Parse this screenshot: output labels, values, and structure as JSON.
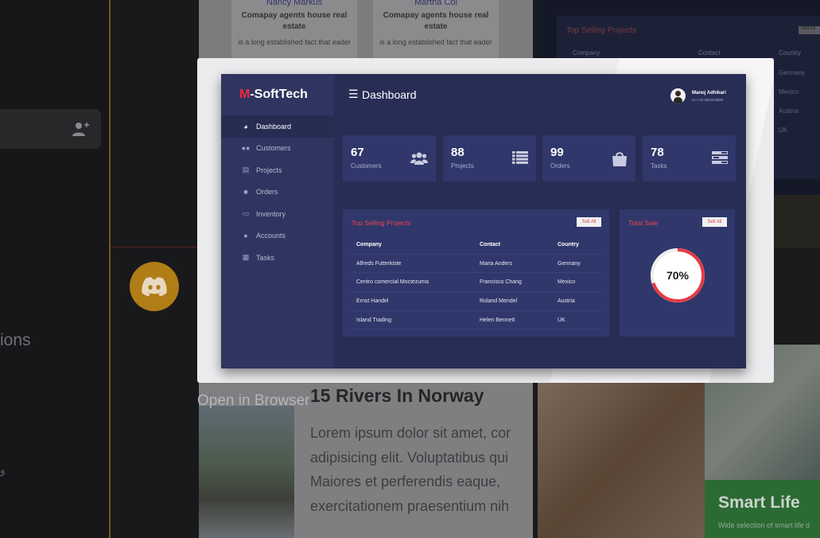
{
  "background": {
    "left_text": "ions",
    "left_small": "و",
    "cards": [
      {
        "name": "Nancy Markus",
        "company": "Comapay agents house real estate",
        "desc": "is a long established fact that eader"
      },
      {
        "name": "Martha Col",
        "company": "Comapay agents house real estate",
        "desc": "is a long established fact that eader"
      }
    ],
    "right_panel": {
      "title": "Top Selling Projects",
      "button": "Sell All",
      "headers": [
        "Company",
        "Contact",
        "Country"
      ],
      "countries": [
        "Germany",
        "Mexico",
        "Austria",
        "UK"
      ]
    },
    "article": {
      "title": "15 Rivers In Norway",
      "lines": [
        "Lorem ipsum dolor sit amet, cor",
        "adipisicing elit. Voluptatibus qui",
        "Maiores et perferendis eaque,",
        "exercitationem praesentium nih"
      ]
    },
    "promo": {
      "title": "Smart Life",
      "subtitle": "Wide selection of smart life d"
    },
    "open_in_browser": "Open in Browser"
  },
  "dashboard": {
    "logo_prefix": "M",
    "logo_rest": "-SoftTech",
    "header_title": "Dashboard",
    "user": {
      "name": "Manoj Adhikari",
      "role": "UI / UX DESIGNER"
    },
    "nav": [
      {
        "label": "Dashboard",
        "icon": "dashboard-icon",
        "active": true
      },
      {
        "label": "Customers",
        "icon": "users-icon",
        "active": false
      },
      {
        "label": "Projects",
        "icon": "projects-icon",
        "active": false
      },
      {
        "label": "Orders",
        "icon": "bag-icon",
        "active": false
      },
      {
        "label": "Inventory",
        "icon": "inventory-icon",
        "active": false
      },
      {
        "label": "Accounts",
        "icon": "user-icon",
        "active": false
      },
      {
        "label": "Tasks",
        "icon": "tasks-icon",
        "active": false
      }
    ],
    "stats": [
      {
        "value": "67",
        "label": "Customers",
        "icon": "users-icon"
      },
      {
        "value": "88",
        "label": "Projects",
        "icon": "list-icon"
      },
      {
        "value": "99",
        "label": "Orders",
        "icon": "bag-icon"
      },
      {
        "value": "78",
        "label": "Tasks",
        "icon": "tasks-icon"
      }
    ],
    "top_selling": {
      "title": "Top Selling Projects",
      "button": "Sell All",
      "headers": [
        "Company",
        "Contact",
        "Country"
      ],
      "rows": [
        [
          "Alfreds Futterkiste",
          "Maria Anders",
          "Germany"
        ],
        [
          "Centro comercial Moctezuma",
          "Francisco Chang",
          "Mexico"
        ],
        [
          "Ernst Handel",
          "Roland Mendel",
          "Austria"
        ],
        [
          "Island Trading",
          "Helen Bennett",
          "UK"
        ]
      ]
    },
    "total_sale": {
      "title": "Total Sale",
      "button": "Sell All",
      "percent_label": "70%",
      "percent": 70
    },
    "colors": {
      "accent": "#ee2b3a",
      "panel": "#30376a",
      "bg": "#272d55"
    }
  }
}
